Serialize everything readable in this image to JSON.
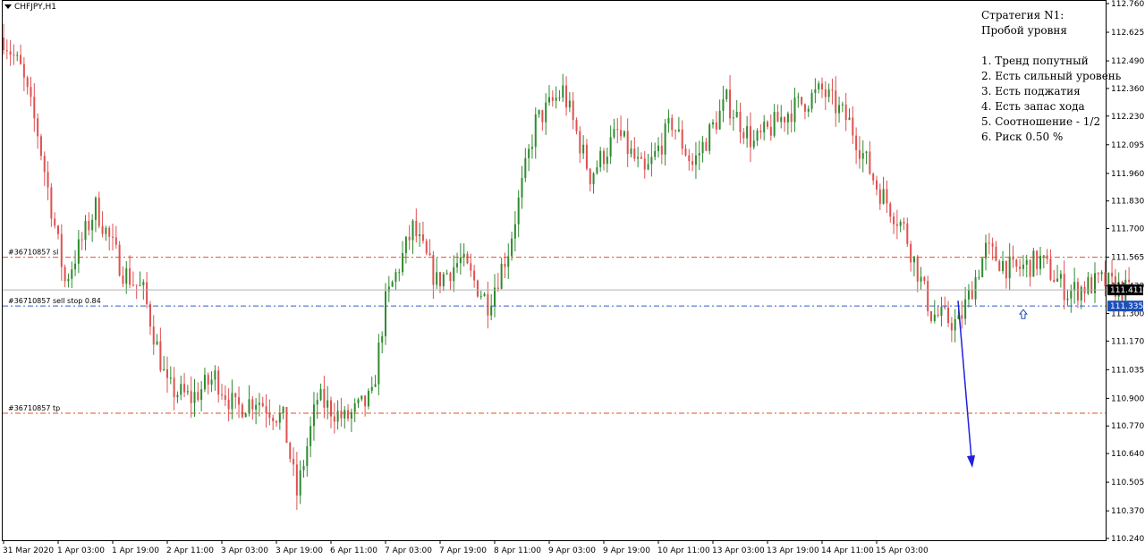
{
  "symbol": "CHFJPY,H1",
  "strategy": {
    "title": "Стратегия N1:",
    "subtitle": "Пробой уровня",
    "items": [
      "1. Тренд попутный",
      "2. Есть сильный уровень",
      "3. Есть поджатия",
      "4. Есть запас хода",
      "5. Соотношение - 1/2",
      "6. Риск 0.50 %"
    ]
  },
  "chart_data": {
    "type": "candlestick",
    "ylim": [
      110.24,
      112.76
    ],
    "y_ticks": [
      "112.760",
      "112.625",
      "112.490",
      "112.360",
      "112.230",
      "112.095",
      "111.960",
      "111.830",
      "111.700",
      "111.565",
      "111.430",
      "111.300",
      "111.170",
      "111.035",
      "110.900",
      "110.770",
      "110.640",
      "110.505",
      "110.370",
      "110.240"
    ],
    "x_ticks": [
      "31 Mar 2020",
      "1 Apr 03:00",
      "1 Apr 19:00",
      "2 Apr 11:00",
      "3 Apr 03:00",
      "3 Apr 19:00",
      "6 Apr 11:00",
      "7 Apr 03:00",
      "7 Apr 19:00",
      "8 Apr 11:00",
      "9 Apr 03:00",
      "9 Apr 19:00",
      "10 Apr 11:00",
      "13 Apr 03:00",
      "13 Apr 19:00",
      "14 Apr 11:00",
      "15 Apr 03:00"
    ],
    "bars_per_tick": 16,
    "bullish_color": "#2e8b2e",
    "bearish_color": "#e05050",
    "anchors": [
      [
        0,
        112.6
      ],
      [
        5,
        112.45
      ],
      [
        10,
        112.15
      ],
      [
        18,
        111.45
      ],
      [
        27,
        111.8
      ],
      [
        35,
        111.5
      ],
      [
        41,
        111.4
      ],
      [
        48,
        110.95
      ],
      [
        55,
        110.9
      ],
      [
        62,
        111.0
      ],
      [
        68,
        110.85
      ],
      [
        74,
        110.9
      ],
      [
        82,
        110.8
      ],
      [
        86,
        110.45
      ],
      [
        92,
        110.9
      ],
      [
        100,
        110.8
      ],
      [
        108,
        110.9
      ],
      [
        112,
        111.35
      ],
      [
        120,
        111.7
      ],
      [
        127,
        111.45
      ],
      [
        134,
        111.55
      ],
      [
        142,
        111.35
      ],
      [
        148,
        111.6
      ],
      [
        156,
        112.2
      ],
      [
        164,
        112.35
      ],
      [
        172,
        111.95
      ],
      [
        180,
        112.15
      ],
      [
        188,
        111.95
      ],
      [
        196,
        112.2
      ],
      [
        202,
        112.0
      ],
      [
        212,
        112.3
      ],
      [
        220,
        112.1
      ],
      [
        230,
        112.25
      ],
      [
        240,
        112.35
      ],
      [
        248,
        112.2
      ],
      [
        256,
        111.9
      ],
      [
        264,
        111.7
      ],
      [
        272,
        111.3
      ],
      [
        280,
        111.25
      ],
      [
        288,
        111.6
      ],
      [
        296,
        111.5
      ],
      [
        304,
        111.55
      ],
      [
        312,
        111.4
      ],
      [
        322,
        111.45
      ],
      [
        330,
        111.4
      ]
    ],
    "bid_price": 111.411,
    "bid_label": "111.411",
    "order_price": 111.335,
    "order_label": "111.335",
    "sl_price": 111.565,
    "tp_price": 110.83,
    "sl_text": "#36710857 sl",
    "order_text": "#36710857 sell stop 0.84",
    "tp_text": "#36710857 tp",
    "order_line_color": "#3060c0",
    "level_line_color": "#e05020",
    "arrow_color": "#2020dd"
  }
}
